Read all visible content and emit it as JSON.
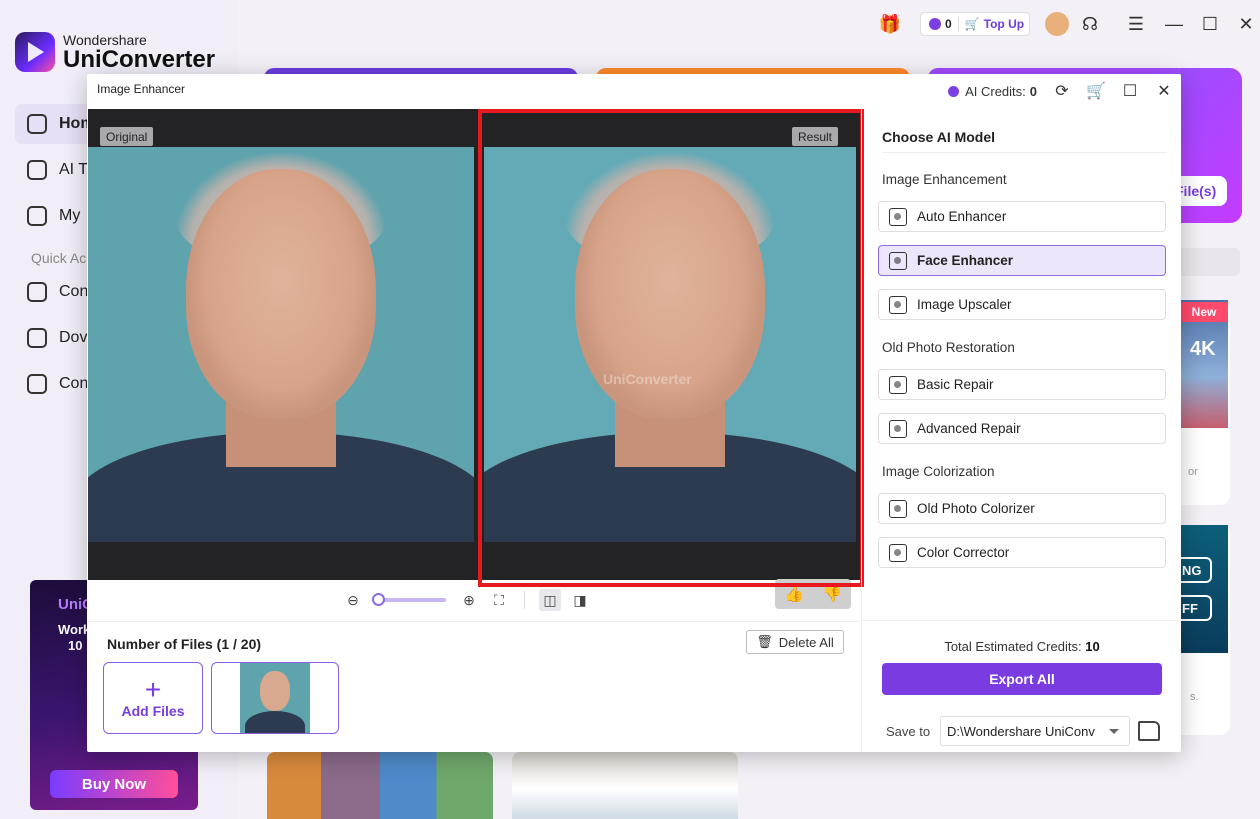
{
  "app": {
    "brand": "Wondershare",
    "product": "UniConverter",
    "nav": [
      "Hom",
      "AI To",
      "My"
    ],
    "quick_label": "Quick Ac",
    "quick_items": [
      "Con",
      "Dov",
      "Con"
    ],
    "promo_title": "UniC",
    "promo_line1": "Work",
    "promo_line2": "10",
    "buy_now": "Buy Now"
  },
  "topbar": {
    "credits": "0",
    "top_up": "Top Up"
  },
  "bg_cards": {
    "add_files_partial": "File(s)",
    "new_badge": "New",
    "label_4k": "4K",
    "partial_or": "or",
    "ng": "NG",
    "ff": "FF",
    "partial_s": "s."
  },
  "modal": {
    "title": "Image Enhancer",
    "ai_credits_label": "AI Credits:",
    "ai_credits_value": "0",
    "tag_original": "Original",
    "tag_result": "Result",
    "watermark": "UniConverter",
    "zoom_level": 0.0,
    "files_count": "Number of Files (1 / 20)",
    "delete_all": "Delete All",
    "add_files": "Add Files"
  },
  "panel": {
    "title": "Choose AI Model",
    "sections": [
      {
        "label": "Image Enhancement",
        "items": [
          {
            "label": "Auto Enhancer",
            "icon": "auto-enhancer-icon",
            "active": false
          },
          {
            "label": "Face Enhancer",
            "icon": "face-enhancer-icon",
            "active": true
          },
          {
            "label": "Image Upscaler",
            "icon": "upscaler-icon",
            "active": false
          }
        ]
      },
      {
        "label": "Old Photo Restoration",
        "items": [
          {
            "label": "Basic Repair",
            "icon": "basic-repair-icon",
            "active": false
          },
          {
            "label": "Advanced Repair",
            "icon": "advanced-repair-icon",
            "active": false
          }
        ]
      },
      {
        "label": "Image Colorization",
        "items": [
          {
            "label": "Old Photo Colorizer",
            "icon": "colorizer-icon",
            "active": false
          },
          {
            "label": "Color Corrector",
            "icon": "color-corrector-icon",
            "active": false
          }
        ]
      }
    ],
    "est_credits_label": "Total Estimated Credits:",
    "est_credits_value": "10",
    "export_all": "Export All",
    "save_to_label": "Save to",
    "save_path": "D:\\Wondershare UniConv"
  },
  "colors": {
    "accent": "#7a3ce0",
    "highlight_box": "#e8181f"
  }
}
